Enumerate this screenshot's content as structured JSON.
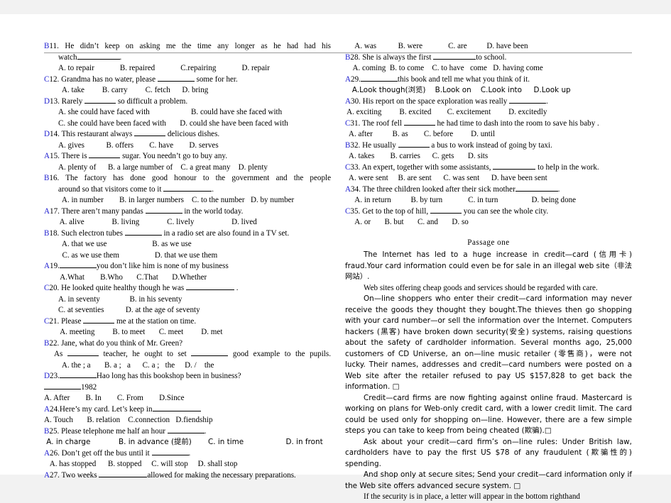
{
  "document": {
    "type": "english-exam-worksheet",
    "page_background": "#ffffff",
    "answer_key_color": "#2020d0"
  },
  "left_column": {
    "questions": [
      {
        "answer": "B",
        "number": "11.",
        "stem_line1": "He didn’t keep on asking me the time any longer as he had had his",
        "stem_line2": "watch",
        "stem_tail": ".",
        "options": "A. to repair             B. repaired             C.repairing             D. repair"
      },
      {
        "answer": "C",
        "number": "12.",
        "stem_line1": "Grandma has no water, please",
        "stem_tail": "some for her.",
        "options": "  A. take         B. carry         C. fetch      D. bring"
      },
      {
        "answer": "D",
        "number": "13.",
        "stem_line1": "Rarely",
        "stem_tail": "so difficult a problem.",
        "options_line1": "A. she could have faced with                     B. could have she faced with",
        "options_line2": "C. she could have been faced with       D. could she have been faced with"
      },
      {
        "answer": "D",
        "number": "14.",
        "stem_line1": "This restaurant always",
        "stem_tail": "delicious dishes.",
        "options": "A. gives           B. offers        C. have        D. serves"
      },
      {
        "answer": "A",
        "number": "15.",
        "stem_line1": "There is",
        "stem_tail": "sugar. You needn’t go to buy any.",
        "options": "A. plenty of      B. a large number of    C. a great many    D. plenty"
      },
      {
        "answer": "B",
        "number": "16.",
        "stem_line1": "The factory has done good honour to the government and the people",
        "stem_line2": "around so that visitors come to it",
        "stem_tail": ".",
        "options": "  A. in number        B. in larger numbers    C. to the number   D. by number"
      },
      {
        "answer": "A",
        "number": "17.",
        "stem_line1": "There aren’t many pandas",
        "stem_tail": "in the world today.",
        "options": "        A. alive              B. living              C. lively                   D. lived"
      },
      {
        "answer": "B",
        "number": "18.",
        "stem_line1": "Such electron tubes",
        "stem_tail": "in a radio set are also found in a TV set.",
        "options_line1": "  A. that we use                       B. as we use",
        "options_line2": "  C. as we use them                  D. that we use them"
      },
      {
        "answer": "A",
        "number": "19.",
        "stem_tail": "you don’t like   him is none of my business",
        "options": " A.What        B.Who       C.That       D.Whether"
      },
      {
        "answer": "C",
        "number": "20.",
        "stem_line1": "He looked quite healthy though he was",
        "stem_tail": ".",
        "options_line1": "A. in seventy               B. in his seventy",
        "options_line2": "C. at seventies           D. at the age of seventy"
      },
      {
        "answer": "C",
        "number": "21.",
        "stem_line1": "Please",
        "stem_tail": "me at the station on time.",
        "options": " A. meeting         B. to meet       C. meet         D. met"
      },
      {
        "answer": "B",
        "number": "22.",
        "stem_line1": "Jane, what do you think of Mr. Green?",
        "stem_line2": "As",
        "stem_line2_mid": "teacher, he ought to set",
        "stem_line2_tail": "good example to the pupils.",
        "options": "  A. the ; a       B. a ;   a      C. a ;   the     D. /    the"
      },
      {
        "answer": "D",
        "number": "23.",
        "stem_tail": "Hao   long   has   this bookshop been   in   business?",
        "stem_line2_tail": "1982",
        "options": "A. After        B. In        C. From        D.Since"
      },
      {
        "answer": "A",
        "number": "24.",
        "stem_line1": "Here’s   my   card.   Let’s   keep   in",
        "options": "A. Touch       B. relation    C.connection   D.fiendship"
      },
      {
        "answer": "B",
        "number": "25.",
        "stem_line1": "Please telephone me half an hour",
        "stem_tail": ".",
        "options": " A. in charge            B. in advance (提前)       C. in time                  D. in front"
      },
      {
        "answer": "A",
        "number": "26.",
        "stem_line1": "Don’t get off the bus until it",
        "stem_tail": ".",
        "options": "   A. has stopped      B. stopped     C. will stop     D. shall stop"
      },
      {
        "answer": "A",
        "number": "27.",
        "stem_line1": "Two weeks",
        "stem_tail": "allowed for making the necessary preparations."
      }
    ]
  },
  "right_column": {
    "questions": [
      {
        "answer": "",
        "number": "",
        "options": "     A. was           B. were             C. are          D. have been"
      },
      {
        "answer": "B",
        "number": "28.",
        "stem_line1": "She is always the first",
        "stem_tail": "to school.",
        "options": "    A. coming  B. to come    C. to have   come   D. having come"
      },
      {
        "answer": "A",
        "number": "29.",
        "stem_tail": "this   book   and   tell   me   what   you   think   of   it.",
        "options": "   A.Look though(浏览)    B.Look on    C.Look into     D.Look up"
      },
      {
        "answer": "A",
        "number": "30.",
        "stem_line1": "His report on the space exploration was really",
        "stem_tail": ".",
        "options": " A. exciting         B. excited        C. excitement         D. excitedly"
      },
      {
        "answer": "C",
        "number": "31.",
        "stem_line1": "The roof fell",
        "stem_tail": "he had time to dash into the room to save his baby .",
        "options": "  A. after          B. as        C. before         D. until"
      },
      {
        "answer": "B",
        "number": "32.",
        "stem_line1": "He usually",
        "stem_tail": "a bus to work instead of going by taxi.",
        "options": "  A. takes        B. carries      C. gets       D. sits"
      },
      {
        "answer": "C",
        "number": "33.",
        "stem_line1": "An expert, together with some assistants,",
        "stem_tail": "to help in the work.",
        "options": "  A. were sent     B. are sent      C. was sent      D. have been sent"
      },
      {
        "answer": "A",
        "number": "34.",
        "stem_line1": "The three children looked after their sick mother",
        "stem_tail": ".",
        "options": "     A. in return          B. by turn             C. in turn                 D. being done"
      },
      {
        "answer": "C",
        "number": "35.",
        "stem_line1": "Get to the top of hill,",
        "stem_tail": "you can see the whole city.",
        "options": "     A. or       B. but       C. and       D. so"
      }
    ],
    "passage": {
      "title": "Passage    one",
      "paragraphs": [
        "The Internet has led to a huge increase in credit—card (信用卡) fraud.Your card information could even be for sale in an illegal web site（非法网站）.",
        "Web sites offering cheap goods and services should be regarded with care.",
        "On—line shoppers who enter their credit—card information may never receive the goods they thought they bought.The thieves then go shopping with your card number—or sell the information over the Internet. Computers hackers (黑客) have broken down security(安全) systems, raising questions about the safety of cardholder information. Several months ago, 25,000 customers of CD Universe, an on—line music retailer (零售商)，were not lucky. Their names, addresses and credit—card numbers were posted on a Web site after the retailer refused to pay US $157,828 to get back the information. □",
        "Credit—card firms are now fighting against online fraud. Mastercard is working on plans for Web‐only credit card, with a lower credit limit. The card could be used only for shopping on—line. However, there are a few simple steps you can take to keep from being cheated (欺骗).□",
        "Ask about your credit—card firm’s  on—line rules: Under British law, cardholders have to pay the first US $78 of any fraudulent (欺骗性的) spending.",
        "And shop only at secure sites; Send your credit—card information only if the Web site offers advanced secure system. □",
        "If the security is in place, a letter will appear in the bottom righthand"
      ]
    }
  }
}
